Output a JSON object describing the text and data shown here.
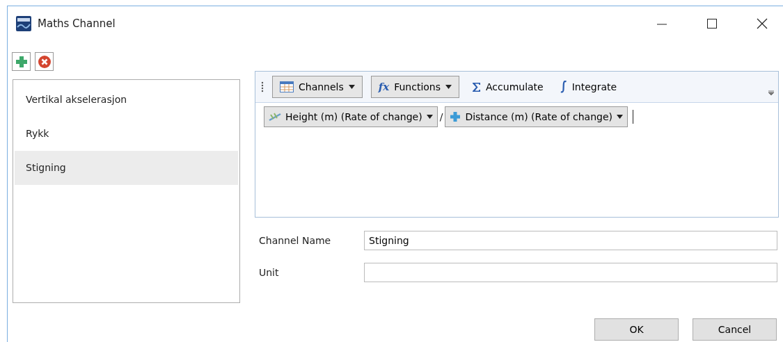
{
  "window": {
    "title": "Maths Channel"
  },
  "channel_list": [
    {
      "label": "Vertikal akselerasjon",
      "selected": false
    },
    {
      "label": "Rykk",
      "selected": false
    },
    {
      "label": "Stigning",
      "selected": true
    }
  ],
  "toolbar": [
    {
      "kind": "dropdown",
      "label": "Channels"
    },
    {
      "kind": "dropdown",
      "label": "Functions",
      "icon_text": "fx"
    },
    {
      "kind": "button",
      "label": "Accumulate"
    },
    {
      "kind": "button",
      "label": "Integrate"
    }
  ],
  "expression": [
    {
      "kind": "channel",
      "label": "Height (m) (Rate of change)"
    },
    {
      "kind": "operator",
      "label": "/"
    },
    {
      "kind": "channel",
      "label": "Distance (m) (Rate of change)"
    }
  ],
  "fields": [
    {
      "label": "Channel Name",
      "value": "Stigning"
    },
    {
      "label": "Unit"
    }
  ],
  "buttons": [
    "OK",
    "Cancel"
  ]
}
